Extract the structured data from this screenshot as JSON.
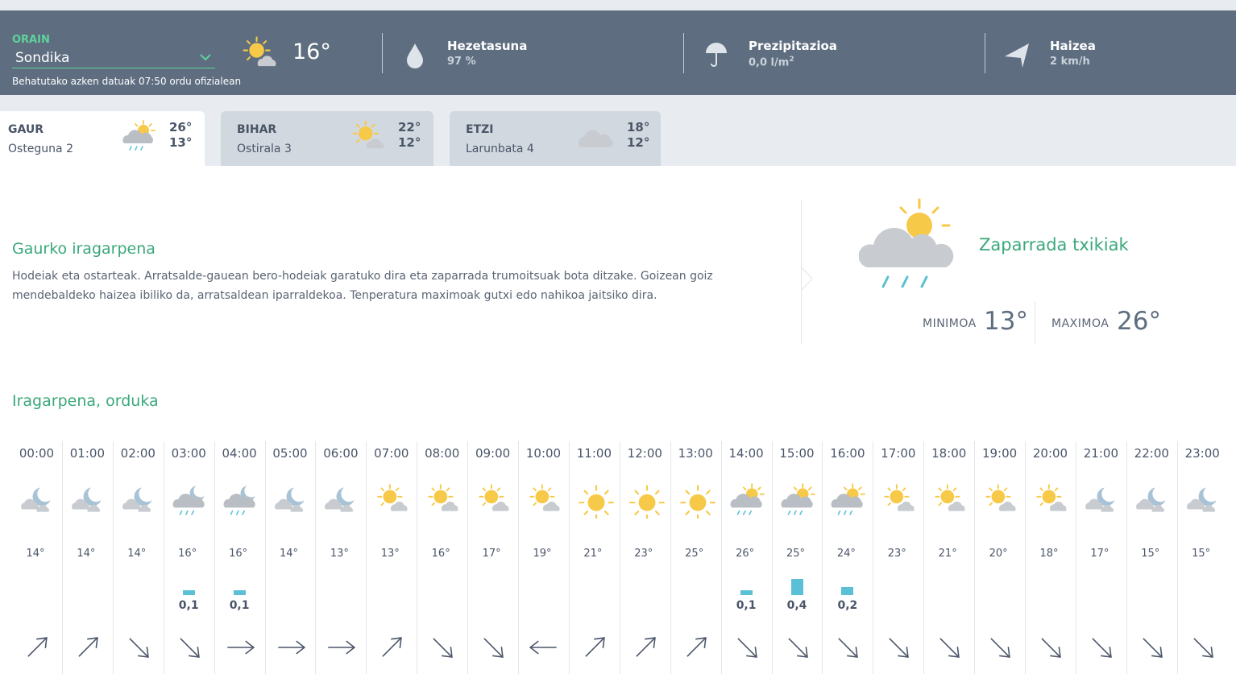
{
  "now": {
    "label": "ORAIN",
    "location": "Sondika",
    "observation_note": "Behatutako azken datuak 07:50 ordu ofizialean",
    "temperature": "16°",
    "icon": "sun-cloud-icon",
    "humidity": {
      "title": "Hezetasuna",
      "value": "97 %",
      "icon": "droplet-icon"
    },
    "precipitation": {
      "title": "Prezipitazioa",
      "value": "0,0 l/m",
      "unit_sup": "2",
      "icon": "umbrella-icon"
    },
    "wind": {
      "title": "Haizea",
      "value": "2 km/h",
      "icon": "wind-direction-icon"
    }
  },
  "days": [
    {
      "name": "GAUR",
      "date": "Osteguna 2",
      "max": "26°",
      "min": "13°",
      "icon": "sun-cloud-rain-icon",
      "active": true
    },
    {
      "name": "BIHAR",
      "date": "Ostirala 3",
      "max": "22°",
      "min": "12°",
      "icon": "sun-cloud-icon",
      "active": false
    },
    {
      "name": "ETZI",
      "date": "Larunbata 4",
      "max": "18°",
      "min": "12°",
      "icon": "cloud-icon",
      "active": false
    }
  ],
  "forecast": {
    "title": "Gaurko iragarpena",
    "text": "Hodeiak eta ostarteak. Arratsalde-gauean bero-hodeiak garatuko dira eta zaparrada trumoitsuak bota ditzake. Goizean goiz mendebaldeko haizea ibiliko da, arratsaldean iparraldekoa. Tenperatura maximoak gutxi edo nahikoa jaitsiko dira.",
    "summary": "Zaparrada txikiak",
    "min_label": "MINIMOA",
    "min_value": "13°",
    "max_label": "MAXIMOA",
    "max_value": "26°"
  },
  "hourly": {
    "title": "Iragarpena, orduka",
    "hours": [
      {
        "time": "00:00",
        "icon": "moon-cloud",
        "temp": "14°",
        "rain": "",
        "rain_mm": 0,
        "wind_dir": "up-right"
      },
      {
        "time": "01:00",
        "icon": "moon-cloud",
        "temp": "14°",
        "rain": "",
        "rain_mm": 0,
        "wind_dir": "up-right"
      },
      {
        "time": "02:00",
        "icon": "moon-cloud",
        "temp": "14°",
        "rain": "",
        "rain_mm": 0,
        "wind_dir": "down-right"
      },
      {
        "time": "03:00",
        "icon": "moon-cloud-rain",
        "temp": "16°",
        "rain": "0,1",
        "rain_mm": 0.1,
        "wind_dir": "down-right"
      },
      {
        "time": "04:00",
        "icon": "moon-cloud-rain",
        "temp": "16°",
        "rain": "0,1",
        "rain_mm": 0.1,
        "wind_dir": "right"
      },
      {
        "time": "05:00",
        "icon": "moon-cloud",
        "temp": "14°",
        "rain": "",
        "rain_mm": 0,
        "wind_dir": "right"
      },
      {
        "time": "06:00",
        "icon": "moon-cloud",
        "temp": "13°",
        "rain": "",
        "rain_mm": 0,
        "wind_dir": "right"
      },
      {
        "time": "07:00",
        "icon": "sun-cloud",
        "temp": "13°",
        "rain": "",
        "rain_mm": 0,
        "wind_dir": "up-right"
      },
      {
        "time": "08:00",
        "icon": "sun-cloud",
        "temp": "16°",
        "rain": "",
        "rain_mm": 0,
        "wind_dir": "down-right"
      },
      {
        "time": "09:00",
        "icon": "sun-cloud",
        "temp": "17°",
        "rain": "",
        "rain_mm": 0,
        "wind_dir": "down-right"
      },
      {
        "time": "10:00",
        "icon": "sun-cloud",
        "temp": "19°",
        "rain": "",
        "rain_mm": 0,
        "wind_dir": "left"
      },
      {
        "time": "11:00",
        "icon": "sun",
        "temp": "21°",
        "rain": "",
        "rain_mm": 0,
        "wind_dir": "up-right"
      },
      {
        "time": "12:00",
        "icon": "sun",
        "temp": "23°",
        "rain": "",
        "rain_mm": 0,
        "wind_dir": "up-right"
      },
      {
        "time": "13:00",
        "icon": "sun",
        "temp": "25°",
        "rain": "",
        "rain_mm": 0,
        "wind_dir": "up-right"
      },
      {
        "time": "14:00",
        "icon": "sun-cloud-rain",
        "temp": "26°",
        "rain": "0,1",
        "rain_mm": 0.1,
        "wind_dir": "down-right"
      },
      {
        "time": "15:00",
        "icon": "sun-cloud-rain",
        "temp": "25°",
        "rain": "0,4",
        "rain_mm": 0.4,
        "wind_dir": "down-right"
      },
      {
        "time": "16:00",
        "icon": "sun-cloud-rain",
        "temp": "24°",
        "rain": "0,2",
        "rain_mm": 0.2,
        "wind_dir": "down-right"
      },
      {
        "time": "17:00",
        "icon": "sun-cloud",
        "temp": "23°",
        "rain": "",
        "rain_mm": 0,
        "wind_dir": "down-right"
      },
      {
        "time": "18:00",
        "icon": "sun-cloud",
        "temp": "21°",
        "rain": "",
        "rain_mm": 0,
        "wind_dir": "down-right"
      },
      {
        "time": "19:00",
        "icon": "sun-cloud",
        "temp": "20°",
        "rain": "",
        "rain_mm": 0,
        "wind_dir": "down-right"
      },
      {
        "time": "20:00",
        "icon": "sun-cloud",
        "temp": "18°",
        "rain": "",
        "rain_mm": 0,
        "wind_dir": "down-right"
      },
      {
        "time": "21:00",
        "icon": "moon-cloud",
        "temp": "17°",
        "rain": "",
        "rain_mm": 0,
        "wind_dir": "down-right"
      },
      {
        "time": "22:00",
        "icon": "moon-cloud",
        "temp": "15°",
        "rain": "",
        "rain_mm": 0,
        "wind_dir": "down-right"
      },
      {
        "time": "23:00",
        "icon": "moon-cloud",
        "temp": "15°",
        "rain": "",
        "rain_mm": 0,
        "wind_dir": "down-right"
      }
    ]
  },
  "colors": {
    "accent": "#3aa87a",
    "header_bg": "#5e6e80",
    "rain_bar": "#5bc0d6",
    "sun": "#f7c948",
    "cloud": "#c8ccd1"
  }
}
